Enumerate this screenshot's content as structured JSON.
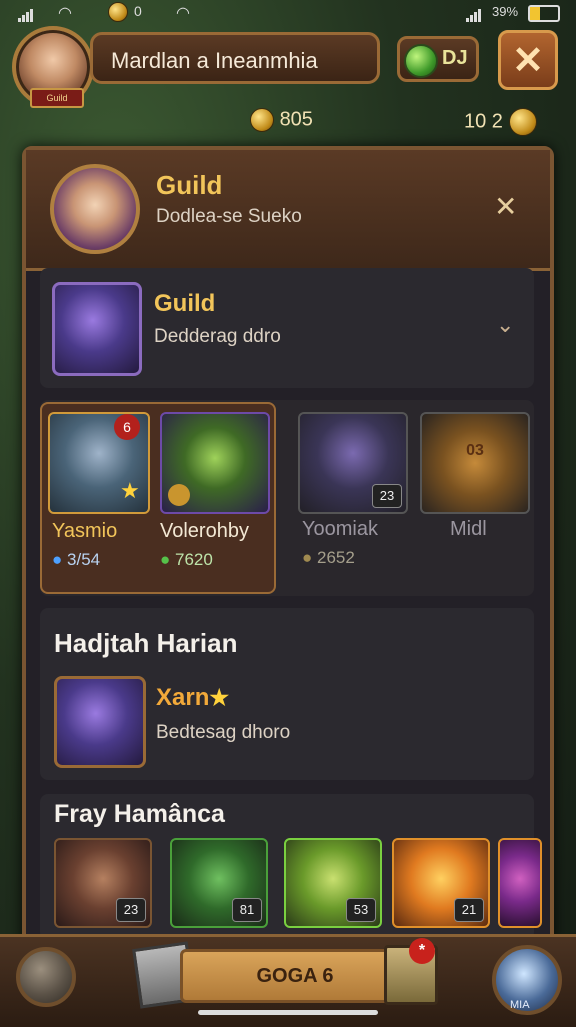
{
  "status": {
    "left_value": "0",
    "battery": "39%"
  },
  "topbar": {
    "player_name": "Mardlan a Ineanmhia",
    "avatar_tag": "Guild",
    "gem_value": "DJ"
  },
  "currency": {
    "left": "805",
    "right": "10 2"
  },
  "guild_header": {
    "title": "Guild",
    "subtitle": "Dodlea-se Sueko"
  },
  "guild_row": {
    "title": "Guild",
    "subtitle": "Dedderag ddro"
  },
  "heroes": [
    {
      "name": "Yasmio",
      "value": "3/54",
      "badge": "6"
    },
    {
      "name": "Volerohby",
      "value": "7620",
      "badge": ""
    },
    {
      "name": "Yoomiak",
      "value": "2652",
      "badge": "23"
    },
    {
      "name": "Midl",
      "value": "",
      "badge": "03"
    }
  ],
  "section_hadjlah": {
    "title": "Hadjtah Harian",
    "item_title": "Xarn",
    "item_sub": "Bedtesag dhoro"
  },
  "section_fray": {
    "title": "Fray Hamânca",
    "items": [
      {
        "badge": "23"
      },
      {
        "badge": "81"
      },
      {
        "badge": "53"
      },
      {
        "badge": "21"
      },
      {
        "badge": ""
      }
    ]
  },
  "bottom": {
    "main_button": "GOGA 6",
    "right_label": "MIA"
  },
  "colors": {
    "gold": "#f2c55a",
    "panel": "#232027",
    "frame": "#7a5532"
  }
}
